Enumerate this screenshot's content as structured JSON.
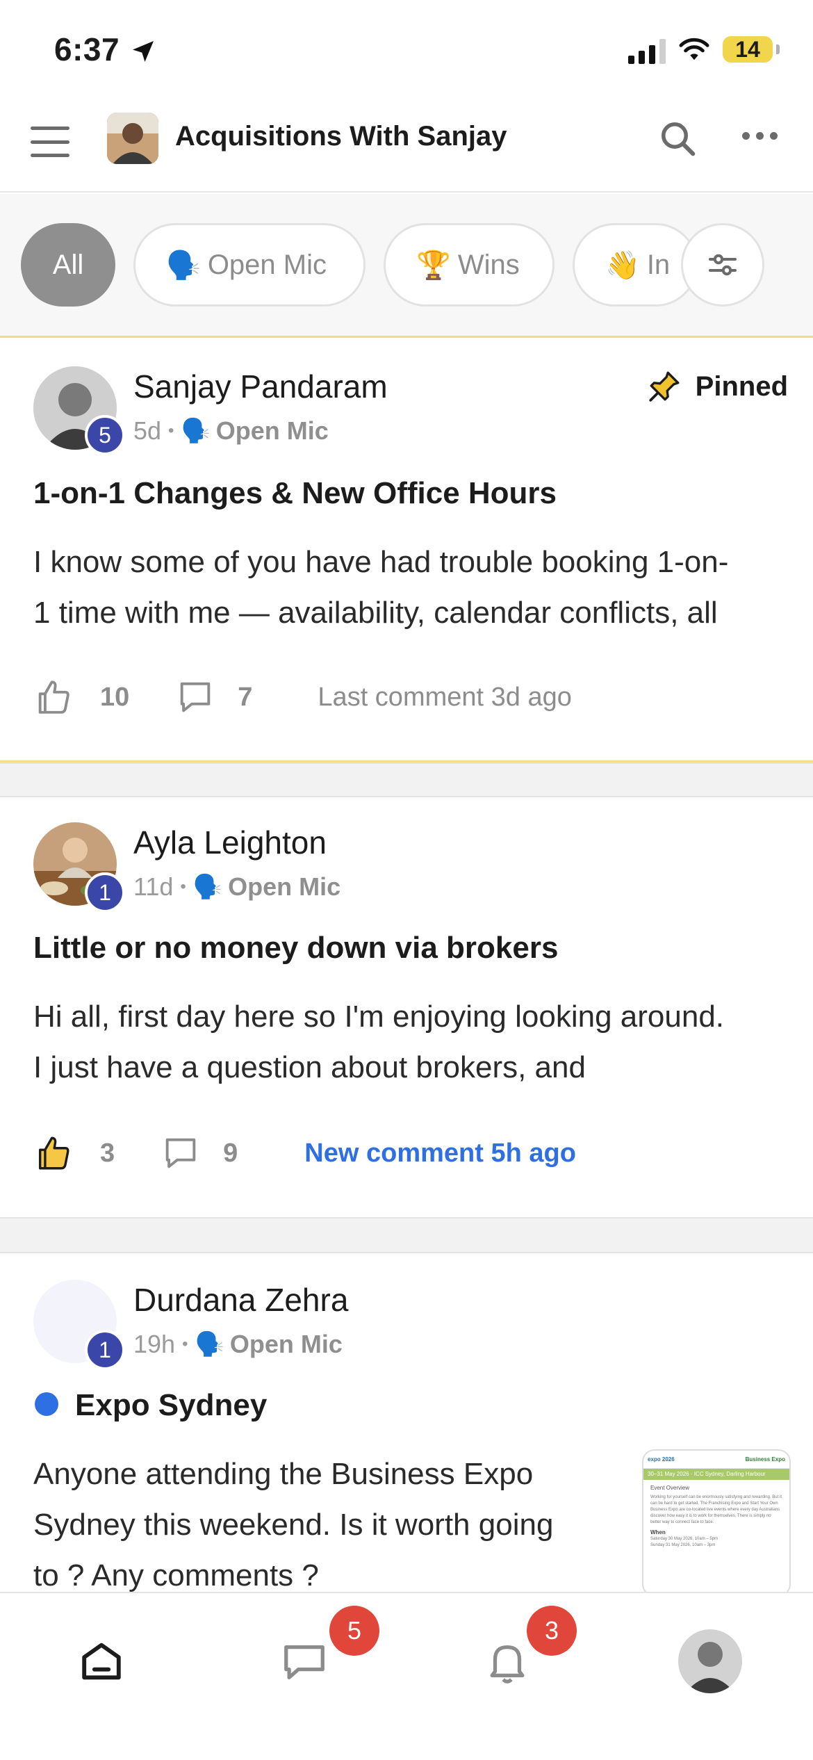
{
  "status_bar": {
    "time": "6:37",
    "battery": "14"
  },
  "header": {
    "group_name": "Acquisitions With Sanjay"
  },
  "filters": [
    {
      "label": "All",
      "emoji": "",
      "active": true
    },
    {
      "label": "Open Mic",
      "emoji": "🗣️",
      "active": false
    },
    {
      "label": "Wins",
      "emoji": "🏆",
      "active": false
    },
    {
      "label": "In",
      "emoji": "👋",
      "active": false
    }
  ],
  "posts": [
    {
      "author": "Sanjay Pandaram",
      "level": "5",
      "age": "5d",
      "category": "Open Mic",
      "category_emoji": "🗣️",
      "pinned_label": "Pinned",
      "title": "1-on-1 Changes & New Office Hours",
      "body_lines": [
        "I know some of you have had trouble booking 1-on-",
        "1 time with me — availability, calendar conflicts, all"
      ],
      "likes": "10",
      "comments": "7",
      "last_comment": "Last comment 3d ago"
    },
    {
      "author": "Ayla Leighton",
      "level": "1",
      "age": "11d",
      "category": "Open Mic",
      "category_emoji": "🗣️",
      "title": "Little or no money down via brokers",
      "body_lines": [
        "Hi all, first day here so I'm enjoying looking around.",
        "I just have a question about brokers, and"
      ],
      "likes": "3",
      "comments": "9",
      "last_comment": "New comment 5h ago"
    },
    {
      "author": "Durdana Zehra",
      "level": "1",
      "age": "19h",
      "category": "Open Mic",
      "category_emoji": "🗣️",
      "title": "Expo Sydney",
      "body_lines": [
        "Anyone attending the Business Expo",
        "Sydney this weekend. Is it worth going",
        "to ? Any comments ?"
      ],
      "thumb": {
        "logo": "expo 2026",
        "brand": "Business Expo",
        "banner": "30–31 May 2026 · ICC Sydney, Darling Harbour",
        "section": "Event Overview",
        "text": "Working for yourself can be enormously satisfying and rewarding. But it can be hard to get started. The Franchising Expo and Start Your Own Business Expo are co-located live events where every day Australians discover how easy it is to work for themselves. There is simply no better way to connect face to face.",
        "when_label": "When",
        "when_1": "Saturday 30 May 2026, 10am – 5pm",
        "when_2": "Sunday 31 May 2026, 10am – 3pm"
      }
    }
  ],
  "bottom_nav": {
    "chat_badge": "5",
    "notif_badge": "3"
  },
  "colors": {
    "accent_blue": "#2f6fe4",
    "badge_red": "#e0463a",
    "level_blue": "#3b47a8",
    "pin_border": "#f6d98a"
  }
}
